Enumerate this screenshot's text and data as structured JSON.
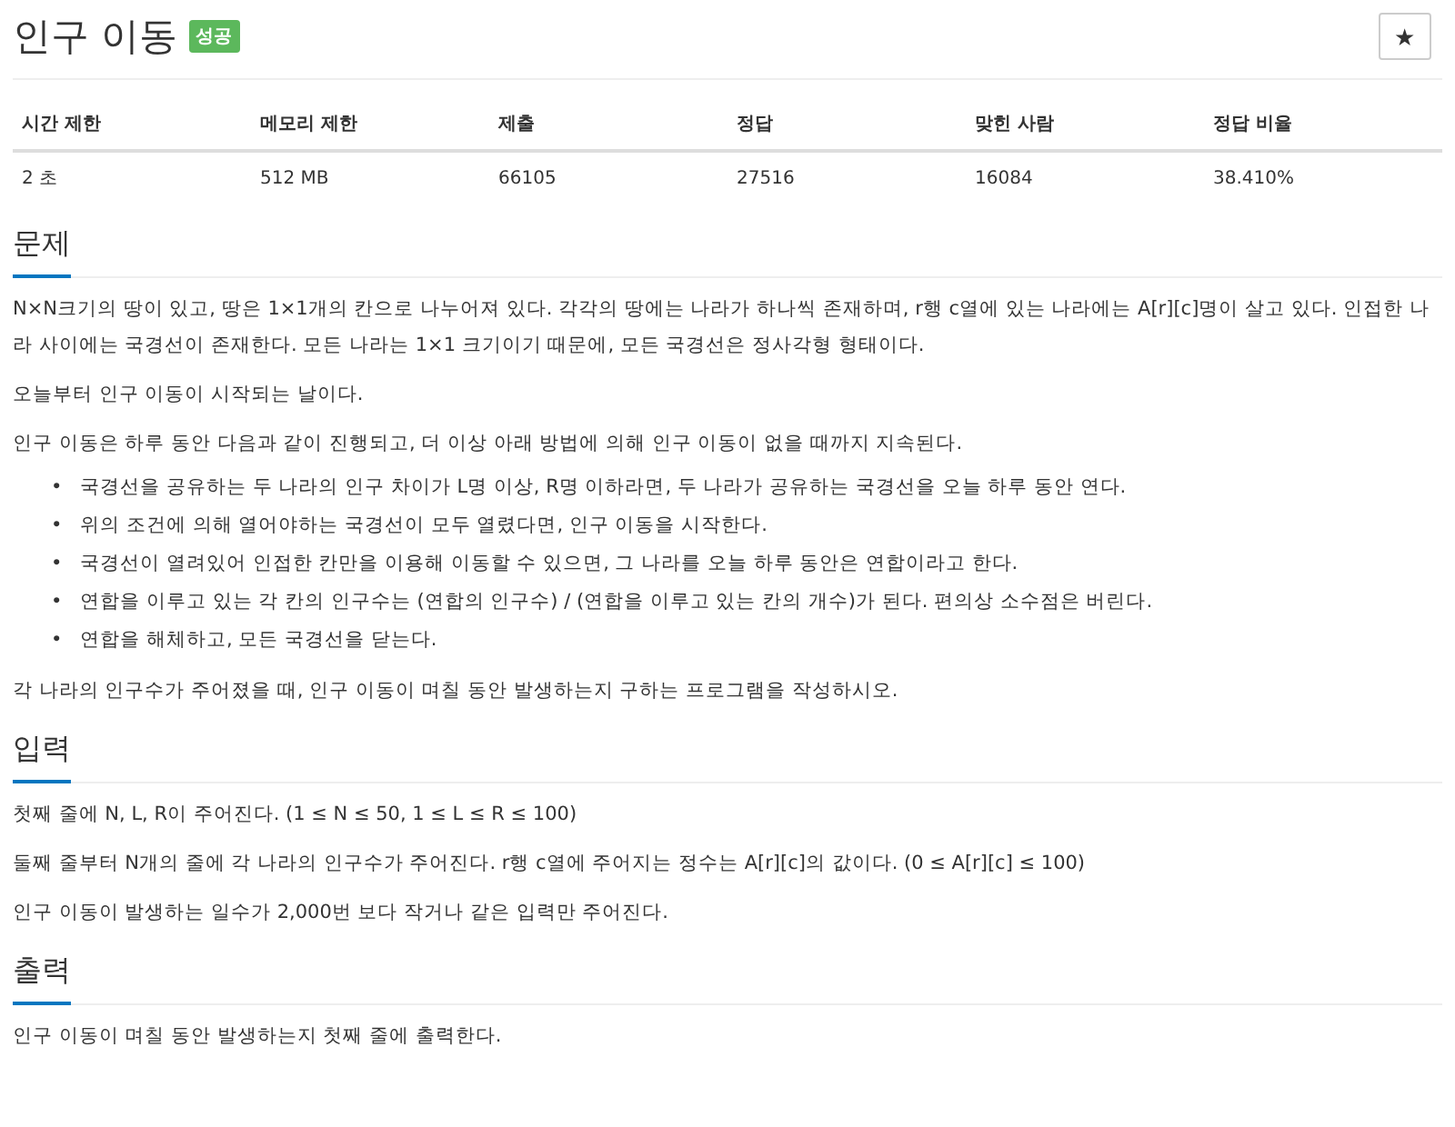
{
  "title": "인구 이동",
  "badge": "성공",
  "star_button": "★",
  "table": {
    "columns": [
      "시간 제한",
      "메모리 제한",
      "제출",
      "정답",
      "맞힌 사람",
      "정답 비율"
    ],
    "rows": [
      [
        "2 초",
        "512 MB",
        "66105",
        "27516",
        "16084",
        "38.410%"
      ]
    ]
  },
  "sections": [
    {
      "heading": "문제",
      "blocks": [
        {
          "kind": "paragraph",
          "text": "N×N크기의 땅이 있고, 땅은 1×1개의 칸으로 나누어져 있다. 각각의 땅에는 나라가 하나씩 존재하며, r행 c열에 있는 나라에는 A[r][c]명이 살고 있다. 인접한 나라 사이에는 국경선이 존재한다. 모든 나라는 1×1 크기이기 때문에, 모든 국경선은 정사각형 형태이다."
        },
        {
          "kind": "paragraph",
          "text": "오늘부터 인구 이동이 시작되는 날이다."
        },
        {
          "kind": "paragraph",
          "text": "인구 이동은 하루 동안 다음과 같이 진행되고, 더 이상 아래 방법에 의해 인구 이동이 없을 때까지 지속된다."
        },
        {
          "kind": "list",
          "marker": "•",
          "items": [
            "국경선을 공유하는 두 나라의 인구 차이가 L명 이상, R명 이하라면, 두 나라가 공유하는 국경선을 오늘 하루 동안 연다.",
            "위의 조건에 의해 열어야하는 국경선이 모두 열렸다면, 인구 이동을 시작한다.",
            "국경선이 열려있어 인접한 칸만을 이용해 이동할 수 있으면, 그 나라를 오늘 하루 동안은 연합이라고 한다.",
            "연합을 이루고 있는 각 칸의 인구수는 (연합의 인구수) / (연합을 이루고 있는 칸의 개수)가 된다. 편의상 소수점은 버린다.",
            "연합을 해체하고, 모든 국경선을 닫는다."
          ]
        },
        {
          "kind": "paragraph",
          "text": "각 나라의 인구수가 주어졌을 때, 인구 이동이 며칠 동안 발생하는지 구하는 프로그램을 작성하시오."
        }
      ]
    },
    {
      "heading": "입력",
      "blocks": [
        {
          "kind": "paragraph",
          "text": "첫째 줄에 N, L, R이 주어진다. (1 ≤ N ≤ 50, 1 ≤ L ≤ R ≤ 100)"
        },
        {
          "kind": "paragraph",
          "text": "둘째 줄부터 N개의 줄에 각 나라의 인구수가 주어진다. r행 c열에 주어지는 정수는 A[r][c]의 값이다. (0 ≤ A[r][c] ≤ 100)"
        },
        {
          "kind": "paragraph",
          "text": "인구 이동이 발생하는 일수가 2,000번 보다 작거나 같은 입력만 주어진다."
        }
      ]
    },
    {
      "heading": "출력",
      "blocks": [
        {
          "kind": "paragraph",
          "text": "인구 이동이 며칠 동안 발생하는지 첫째 줄에 출력한다."
        }
      ]
    }
  ]
}
